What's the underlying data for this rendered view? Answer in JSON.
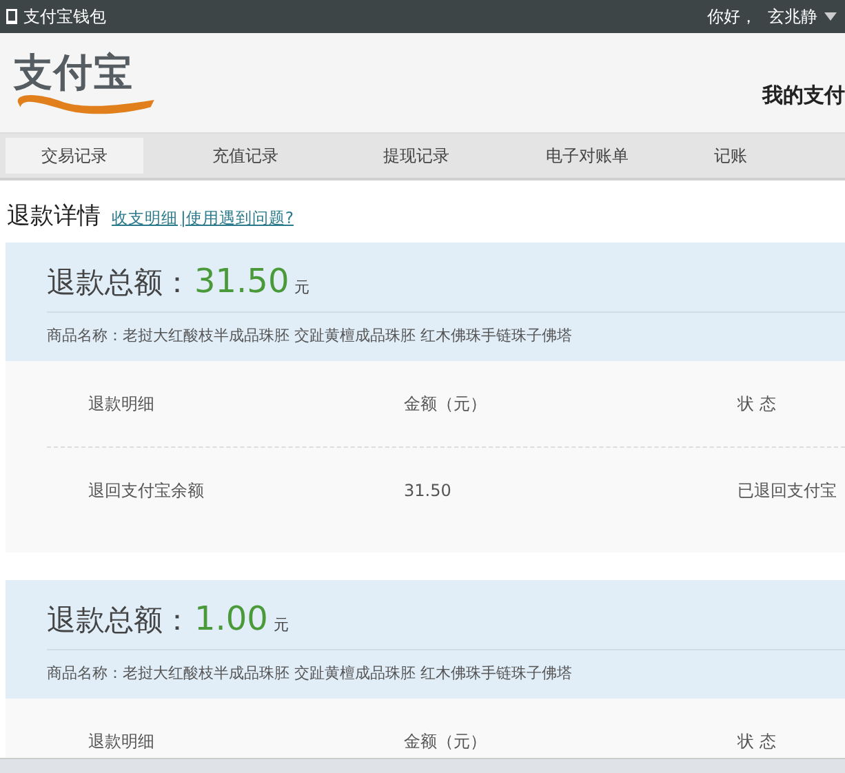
{
  "top_bar": {
    "title": "支付宝钱包",
    "greeting": "你好，",
    "user": "玄兆静"
  },
  "header": {
    "logo": "支付宝",
    "heading": "我的支付"
  },
  "tabs": [
    {
      "label": "交易记录",
      "selected": true
    },
    {
      "label": "充值记录",
      "selected": false
    },
    {
      "label": "提现记录",
      "selected": false
    },
    {
      "label": "电子对账单",
      "selected": false
    },
    {
      "label": "记账",
      "selected": false
    }
  ],
  "page": {
    "title": "退款详情",
    "links": [
      "收支明细",
      "|使用遇到问题?"
    ]
  },
  "refunds": [
    {
      "total_label": "退款总额：",
      "amount": "31.50",
      "unit": "元",
      "product": "商品名称：老挝大红酸枝半成品珠胚 交趾黄檀成品珠胚 红木佛珠手链珠子佛塔",
      "columns": [
        "退款明细",
        "金额（元）",
        "状 态"
      ],
      "rows": [
        [
          "退回支付宝余额",
          "31.50",
          "已退回支付宝"
        ]
      ]
    },
    {
      "total_label": "退款总额：",
      "amount": "1.00",
      "unit": "元",
      "product": "商品名称：老挝大红酸枝半成品珠胚 交趾黄檀成品珠胚 红木佛珠手链珠子佛塔",
      "columns": [
        "退款明细",
        "金额（元）",
        "状 态"
      ]
    }
  ]
}
